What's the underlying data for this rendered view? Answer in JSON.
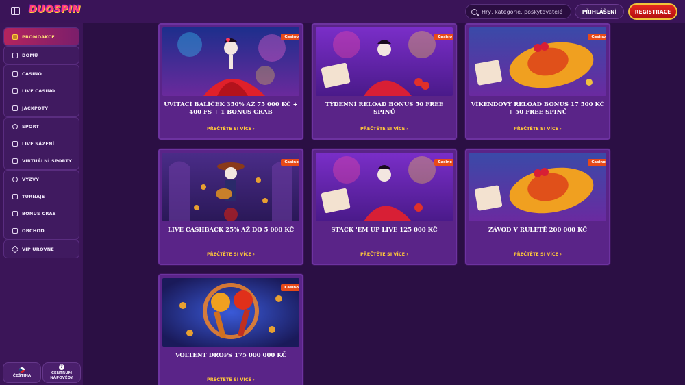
{
  "header": {
    "logo": "DUOSPIN",
    "search_placeholder": "Hry, kategorie, poskytovatelé",
    "login_label": "PŘIHLÁŠENÍ",
    "register_label": "REGISTRACE"
  },
  "sidebar": {
    "promo": "PROMOAKCE",
    "home": "DOMŮ",
    "casino": "CASINO",
    "live_casino": "LIVE CASINO",
    "jackpots": "JACKPOTY",
    "sport": "SPORT",
    "live_bets": "LIVE SÁZENÍ",
    "virtual_sports": "VIRTUÁLNÍ SPORTY",
    "challenges": "VÝZVY",
    "tournaments": "TURNAJE",
    "bonus_crab": "BONUS CRAB",
    "shop": "OBCHOD",
    "vip": "VIP ÚROVNĚ",
    "language": "ČEŠTINA",
    "help_line1": "CENTRUM",
    "help_line2": "NÁPOVĚDY"
  },
  "cards": [
    {
      "badge": "Casino",
      "title": "UVÍTACÍ BALÍČEK 350% AŽ 75 000 KČ + 400 FS + 1 BONUS CRAB",
      "link": "PŘEČTĚTE SI VÍCE ›"
    },
    {
      "badge": "Casino",
      "title": "TÝDENNÍ RELOAD BONUS 50 FREE SPINŮ",
      "link": "PŘEČTĚTE SI VÍCE ›"
    },
    {
      "badge": "Casino",
      "title": "VÍKENDOVÝ RELOAD BONUS 17 500 KČ + 50 FREE SPINŮ",
      "link": "PŘEČTĚTE SI VÍCE ›"
    },
    {
      "badge": "Casino",
      "title": "LIVE CASHBACK 25% AŽ DO 5 000 KČ",
      "link": "PŘEČTĚTE SI VÍCE ›"
    },
    {
      "badge": "Casino",
      "title": "STACK 'EM UP LIVE 125 000 KČ",
      "link": "PŘEČTĚTE SI VÍCE ›"
    },
    {
      "badge": "Casino",
      "title": "ZÁVOD V RULETĚ 200 000 KČ",
      "link": "PŘEČTĚTE SI VÍCE ›"
    },
    {
      "badge": "Casino",
      "title": "VOLTENT DROPS 175 000 000 KČ",
      "link": "PŘEČTĚTE SI VÍCE ›"
    }
  ]
}
